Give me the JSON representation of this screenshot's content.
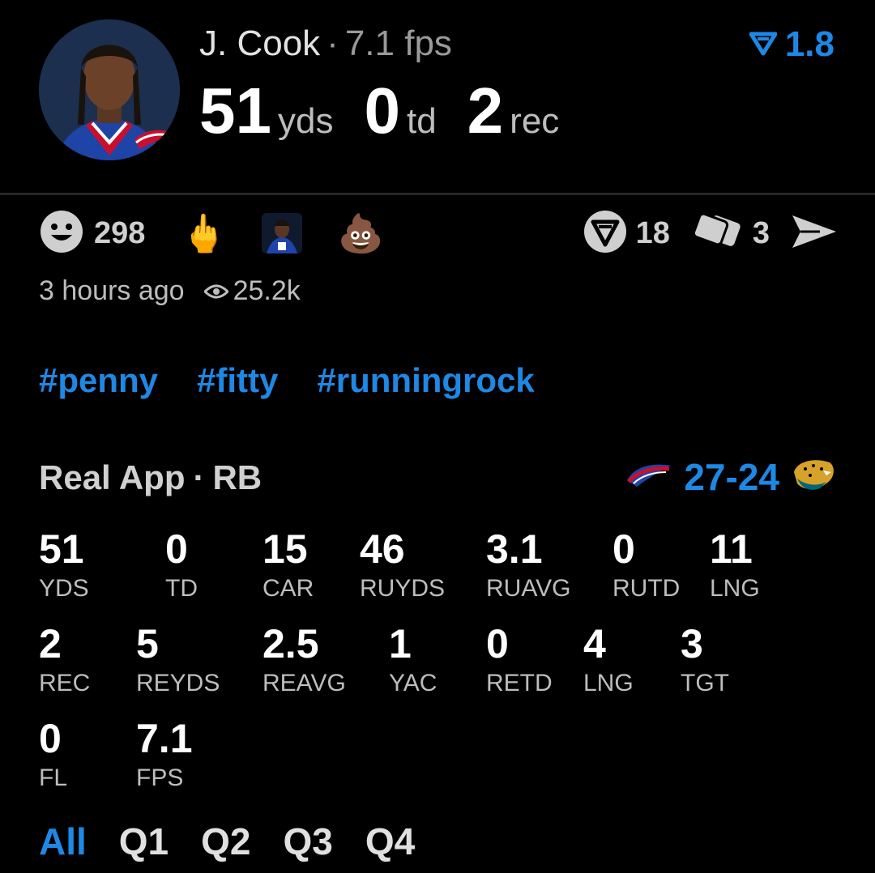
{
  "colors": {
    "accent": "#1e88e5",
    "background": "#000000",
    "muted": "#bdbdbd"
  },
  "header": {
    "player_name": "J. Cook",
    "separator": "·",
    "fps_label": "7.1 fps",
    "rating_value": "1.8",
    "rating_icon": "vote-arrow-icon",
    "yds_value": "51",
    "yds_unit": "yds",
    "td_value": "0",
    "td_unit": "td",
    "rec_value": "2",
    "rec_unit": "rec"
  },
  "reactions": {
    "smiley_count": "298",
    "emoji_1": "🖕",
    "emoji_3": "💩",
    "vote_count": "18",
    "cards_count": "3"
  },
  "meta": {
    "time_ago": "3 hours ago",
    "views": "25.2k"
  },
  "hashtags": [
    "#penny",
    "#fitty",
    "#runningrock"
  ],
  "game": {
    "source": "Real App",
    "separator": "·",
    "position": "RB",
    "score": "27-24"
  },
  "stats": [
    [
      {
        "value": "51",
        "label": "YDS"
      },
      {
        "value": "0",
        "label": "TD"
      },
      {
        "value": "15",
        "label": "CAR"
      },
      {
        "value": "46",
        "label": "RUYDS"
      },
      {
        "value": "3.1",
        "label": "RUAVG"
      },
      {
        "value": "0",
        "label": "RUTD"
      },
      {
        "value": "11",
        "label": "LNG"
      }
    ],
    [
      {
        "value": "2",
        "label": "REC"
      },
      {
        "value": "5",
        "label": "REYDS"
      },
      {
        "value": "2.5",
        "label": "REAVG"
      },
      {
        "value": "1",
        "label": "YAC"
      },
      {
        "value": "0",
        "label": "RETD"
      },
      {
        "value": "4",
        "label": "LNG"
      },
      {
        "value": "3",
        "label": "TGT"
      }
    ],
    [
      {
        "value": "0",
        "label": "FL"
      },
      {
        "value": "7.1",
        "label": "FPS"
      }
    ]
  ],
  "tabs": [
    {
      "label": "All",
      "active": true
    },
    {
      "label": "Q1",
      "active": false
    },
    {
      "label": "Q2",
      "active": false
    },
    {
      "label": "Q3",
      "active": false
    },
    {
      "label": "Q4",
      "active": false
    }
  ]
}
